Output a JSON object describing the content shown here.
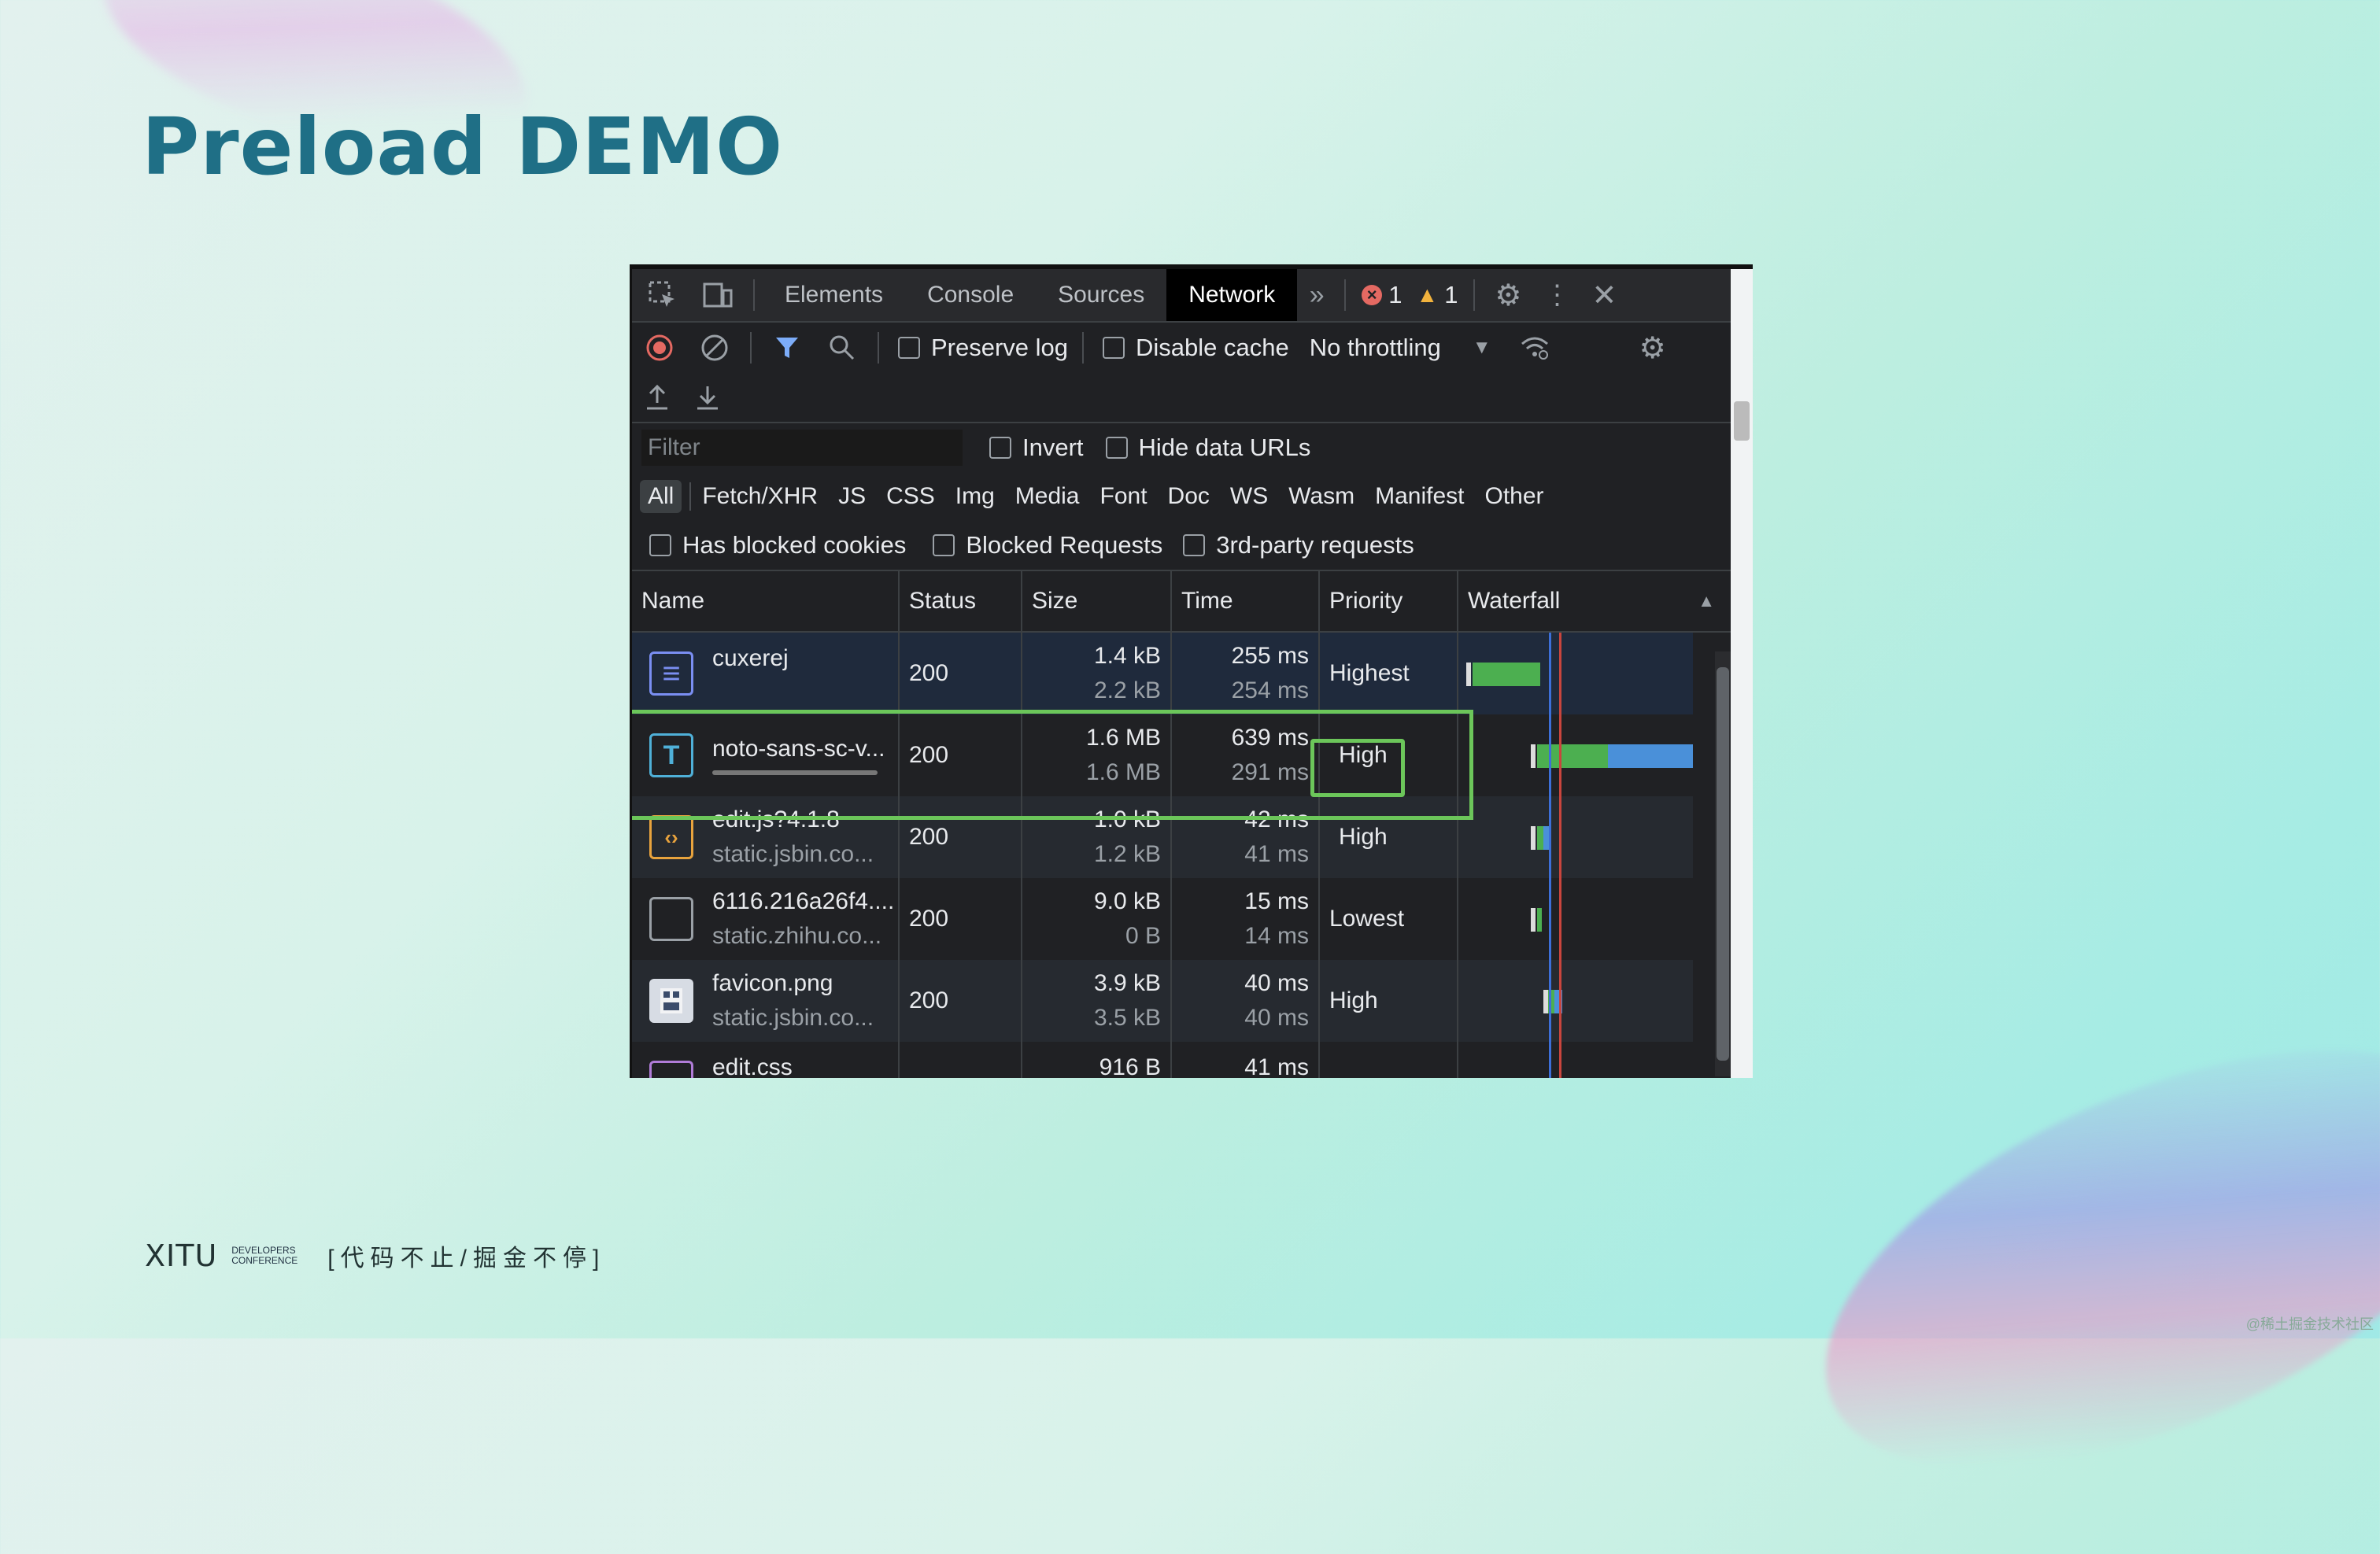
{
  "slide": {
    "title": "Preload DEMO",
    "footer_brand": "XITU",
    "footer_brand_sub1": "DEVELOPERS",
    "footer_brand_sub2": "CONFERENCE",
    "footer_slogan": "[代码不止/掘金不停]",
    "watermark": "@稀土掘金技术社区"
  },
  "devtools": {
    "tabs": [
      "Elements",
      "Console",
      "Sources",
      "Network"
    ],
    "active_tab": "Network",
    "error_count": "1",
    "warning_count": "1",
    "preserve_log": "Preserve log",
    "disable_cache": "Disable cache",
    "throttling": "No throttling",
    "filter_placeholder": "Filter",
    "invert": "Invert",
    "hide_data_urls": "Hide data URLs",
    "types": [
      "All",
      "Fetch/XHR",
      "JS",
      "CSS",
      "Img",
      "Media",
      "Font",
      "Doc",
      "WS",
      "Wasm",
      "Manifest",
      "Other"
    ],
    "has_blocked_cookies": "Has blocked cookies",
    "blocked_requests": "Blocked Requests",
    "third_party": "3rd-party requests",
    "columns": {
      "name": "Name",
      "status": "Status",
      "size": "Size",
      "time": "Time",
      "priority": "Priority",
      "waterfall": "Waterfall"
    },
    "rows": [
      {
        "name": "cuxerej",
        "sub": "",
        "status": "200",
        "size": "1.4 kB",
        "size2": "2.2 kB",
        "time": "255 ms",
        "time2": "254 ms",
        "priority": "Highest",
        "icon": "document-icon"
      },
      {
        "name": "noto-sans-sc-v...",
        "sub": "",
        "status": "200",
        "size": "1.6 MB",
        "size2": "1.6 MB",
        "time": "639 ms",
        "time2": "291 ms",
        "priority": "High",
        "icon": "font-icon"
      },
      {
        "name": "edit.js?4.1.8",
        "sub": "static.jsbin.co...",
        "status": "200",
        "size": "1.0 kB",
        "size2": "1.2 kB",
        "time": "42 ms",
        "time2": "41 ms",
        "priority": "High",
        "icon": "script-icon"
      },
      {
        "name": "6116.216a26f4....",
        "sub": "static.zhihu.co...",
        "status": "200",
        "size": "9.0 kB",
        "size2": "0 B",
        "time": "15 ms",
        "time2": "14 ms",
        "priority": "Lowest",
        "icon": "other-icon"
      },
      {
        "name": "favicon.png",
        "sub": "static.jsbin.co...",
        "status": "200",
        "size": "3.9 kB",
        "size2": "3.5 kB",
        "time": "40 ms",
        "time2": "40 ms",
        "priority": "High",
        "icon": "image-icon"
      },
      {
        "name": "edit.css",
        "sub": "",
        "status": "",
        "size": "916 B",
        "size2": "",
        "time": "41 ms",
        "time2": "",
        "priority": "",
        "icon": "stylesheet-icon"
      }
    ]
  },
  "colors": {
    "accent_green": "#6cc65a",
    "title_teal": "#1f6f86",
    "waterfall_green": "#4caf50",
    "waterfall_blue": "#4a90d9"
  }
}
